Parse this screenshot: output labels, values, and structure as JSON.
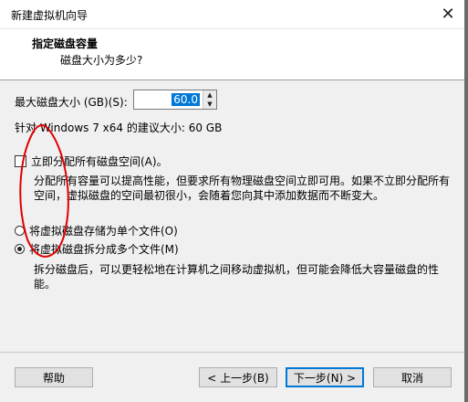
{
  "window": {
    "title": "新建虚拟机向导"
  },
  "header": {
    "title": "指定磁盘容量",
    "subtitle": "磁盘大小为多少?"
  },
  "disk_size": {
    "label": "最大磁盘大小 (GB)(S):",
    "value": "60.0"
  },
  "recommendation": "针对 Windows 7 x64 的建议大小: 60 GB",
  "allocate": {
    "label": "立即分配所有磁盘空间(A)。",
    "checked": false,
    "description": "分配所有容量可以提高性能，但要求所有物理磁盘空间立即可用。如果不立即分配所有空间，虚拟磁盘的空间最初很小，会随着您向其中添加数据而不断变大。"
  },
  "storage": {
    "single": {
      "label": "将虚拟磁盘存储为单个文件(O)",
      "selected": false
    },
    "multiple": {
      "label": "将虚拟磁盘拆分成多个文件(M)",
      "selected": true
    },
    "description": "拆分磁盘后，可以更轻松地在计算机之间移动虚拟机，但可能会降低大容量磁盘的性能。"
  },
  "buttons": {
    "help": "帮助",
    "back": "< 上一步(B)",
    "next": "下一步(N) >",
    "cancel": "取消"
  },
  "colors": {
    "accent": "#0078d7",
    "annotation": "#e00000"
  }
}
